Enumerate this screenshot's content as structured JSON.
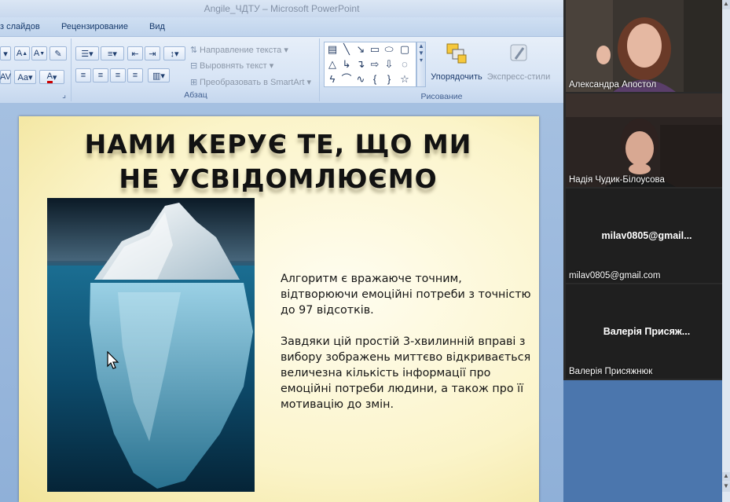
{
  "window": {
    "title": "Angile_ЧДТУ – Microsoft PowerPoint"
  },
  "ribbon": {
    "tabs": [
      "з слайдов",
      "Рецензирование",
      "Вид"
    ],
    "paragraph": {
      "label": "Абзац",
      "text_direction": "Направление текста",
      "align_text": "Выровнять текст",
      "smartart": "Преобразовать в SmartArt"
    },
    "drawing": {
      "label": "Рисование",
      "arrange": "Упорядочить",
      "quick_styles": "Экспресс-стили"
    }
  },
  "slide": {
    "title": "НАМИ КЕРУЄ ТЕ, ЩО МИ НЕ УСВІДОМЛЮЄМО",
    "paragraph1": "Алгоритм є вражаюче точним, відтворюючи емоційні потреби з точністю до 97 відсотків.",
    "paragraph2": "Завдяки цій простій 3-хвилинній вправі з вибору зображень миттєво відкривається величезна кількість інформації про емоційні потреби людини, а також про її мотивацію до змін."
  },
  "participants": [
    {
      "name": "Александра Апостол"
    },
    {
      "name": "Надія Чудик-Білоусова"
    },
    {
      "center": "milav0805@gmail...",
      "name": "milav0805@gmail.com"
    },
    {
      "center": "Валерія Присяж...",
      "name": "Валерія Присяжнюк"
    }
  ],
  "colors": {
    "ribbon": "#dce7f6",
    "slide_background": "#fbf4c9",
    "panel": "#2a2a2a",
    "desktop": "#4b76ad"
  }
}
